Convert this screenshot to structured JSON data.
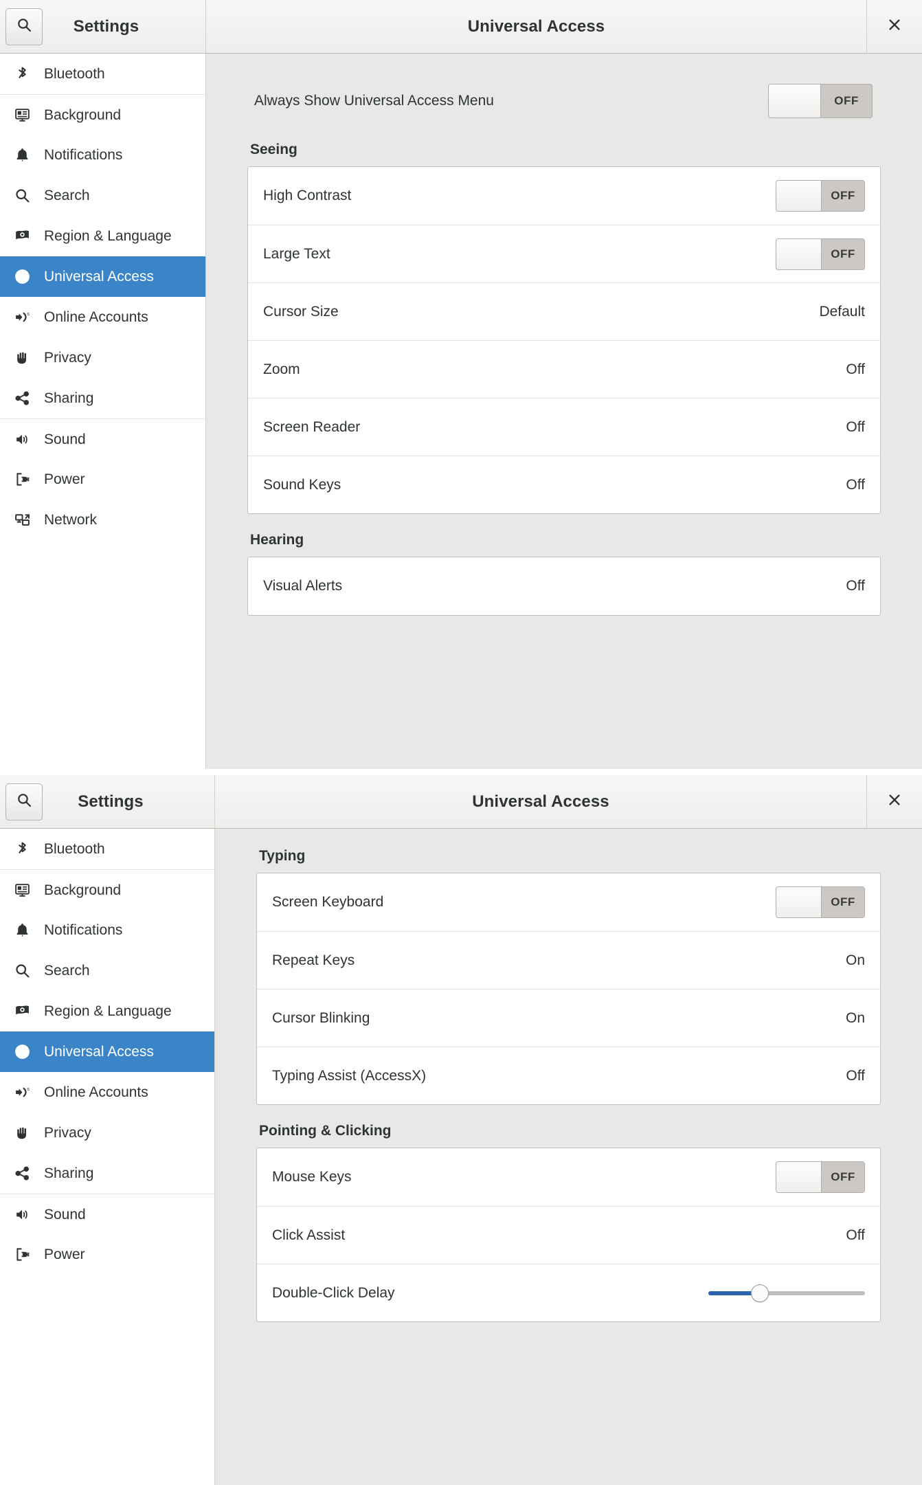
{
  "window_top": {
    "header": {
      "search_icon": "search-icon",
      "sidebar_title": "Settings",
      "content_title": "Universal Access",
      "close_icon": "close-icon"
    },
    "sidebar_items": [
      {
        "label": "Bluetooth",
        "icon": "bluetooth-icon",
        "selected": false,
        "separator": false
      },
      {
        "label": "Background",
        "icon": "background-icon",
        "selected": false,
        "separator": true
      },
      {
        "label": "Notifications",
        "icon": "bell-icon",
        "selected": false,
        "separator": false
      },
      {
        "label": "Search",
        "icon": "search-icon",
        "selected": false,
        "separator": false
      },
      {
        "label": "Region & Language",
        "icon": "flag-icon",
        "selected": false,
        "separator": false
      },
      {
        "label": "Universal Access",
        "icon": "accessibility-icon",
        "selected": true,
        "separator": false
      },
      {
        "label": "Online Accounts",
        "icon": "online-accounts-icon",
        "selected": false,
        "separator": false
      },
      {
        "label": "Privacy",
        "icon": "hand-icon",
        "selected": false,
        "separator": false
      },
      {
        "label": "Sharing",
        "icon": "share-icon",
        "selected": false,
        "separator": false
      },
      {
        "label": "Sound",
        "icon": "speaker-icon",
        "selected": false,
        "separator": true
      },
      {
        "label": "Power",
        "icon": "power-plug-icon",
        "selected": false,
        "separator": false
      },
      {
        "label": "Network",
        "icon": "network-icon",
        "selected": false,
        "separator": false
      }
    ],
    "always_show_menu": {
      "label": "Always Show Universal Access Menu",
      "state": "OFF"
    },
    "sections": [
      {
        "title": "Seeing",
        "rows": [
          {
            "label": "High Contrast",
            "control": "toggle",
            "value": "OFF"
          },
          {
            "label": "Large Text",
            "control": "toggle",
            "value": "OFF"
          },
          {
            "label": "Cursor Size",
            "control": "text",
            "value": "Default"
          },
          {
            "label": "Zoom",
            "control": "text",
            "value": "Off"
          },
          {
            "label": "Screen Reader",
            "control": "text",
            "value": "Off"
          },
          {
            "label": "Sound Keys",
            "control": "text",
            "value": "Off"
          }
        ]
      },
      {
        "title": "Hearing",
        "rows": [
          {
            "label": "Visual Alerts",
            "control": "text",
            "value": "Off"
          }
        ]
      }
    ]
  },
  "window_bottom": {
    "header": {
      "search_icon": "search-icon",
      "sidebar_title": "Settings",
      "content_title": "Universal Access",
      "close_icon": "close-icon"
    },
    "sidebar_items": [
      {
        "label": "Bluetooth",
        "icon": "bluetooth-icon",
        "selected": false,
        "separator": false
      },
      {
        "label": "Background",
        "icon": "background-icon",
        "selected": false,
        "separator": true
      },
      {
        "label": "Notifications",
        "icon": "bell-icon",
        "selected": false,
        "separator": false
      },
      {
        "label": "Search",
        "icon": "search-icon",
        "selected": false,
        "separator": false
      },
      {
        "label": "Region & Language",
        "icon": "flag-icon",
        "selected": false,
        "separator": false
      },
      {
        "label": "Universal Access",
        "icon": "accessibility-icon",
        "selected": true,
        "separator": false
      },
      {
        "label": "Online Accounts",
        "icon": "online-accounts-icon",
        "selected": false,
        "separator": false
      },
      {
        "label": "Privacy",
        "icon": "hand-icon",
        "selected": false,
        "separator": false
      },
      {
        "label": "Sharing",
        "icon": "share-icon",
        "selected": false,
        "separator": false
      },
      {
        "label": "Sound",
        "icon": "speaker-icon",
        "selected": false,
        "separator": true
      },
      {
        "label": "Power",
        "icon": "power-plug-icon",
        "selected": false,
        "separator": false
      }
    ],
    "sections": [
      {
        "title": "Typing",
        "rows": [
          {
            "label": "Screen Keyboard",
            "control": "toggle",
            "value": "OFF"
          },
          {
            "label": "Repeat Keys",
            "control": "text",
            "value": "On"
          },
          {
            "label": "Cursor Blinking",
            "control": "text",
            "value": "On"
          },
          {
            "label": "Typing Assist (AccessX)",
            "control": "text",
            "value": "Off"
          }
        ]
      },
      {
        "title": "Pointing & Clicking",
        "rows": [
          {
            "label": "Mouse Keys",
            "control": "toggle",
            "value": "OFF"
          },
          {
            "label": "Click Assist",
            "control": "text",
            "value": "Off"
          },
          {
            "label": "Double-Click Delay",
            "control": "slider",
            "value": "33"
          }
        ]
      }
    ]
  },
  "theme": {
    "accent": "#3b84c8",
    "slider_fill": "#2d62b0",
    "content_bg": "#e8e8e7",
    "card_bg": "#ffffff"
  }
}
